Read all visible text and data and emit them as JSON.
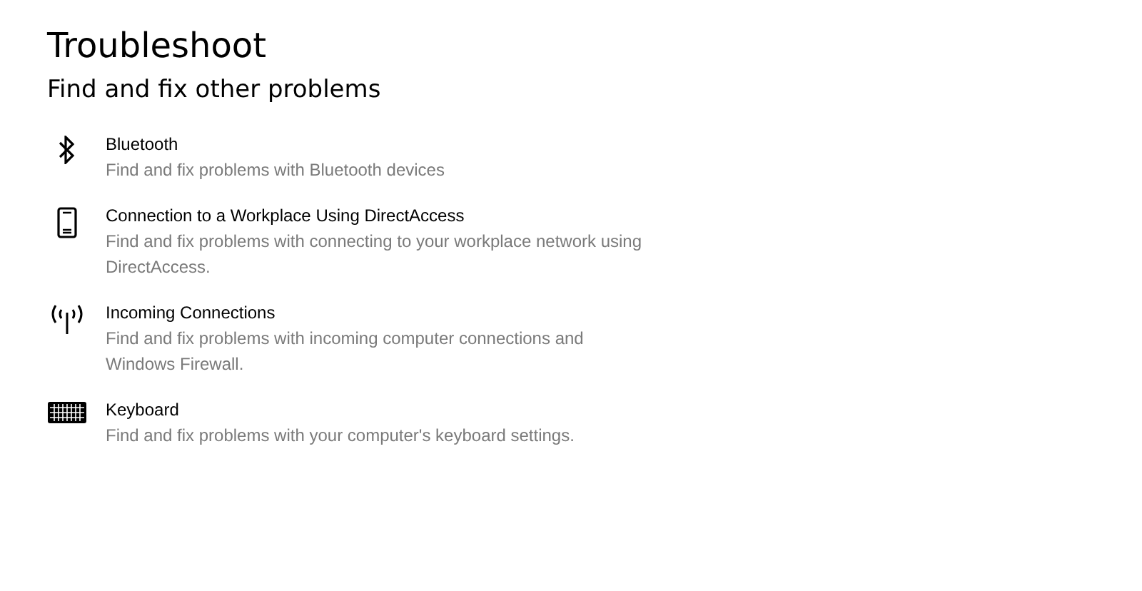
{
  "page": {
    "title": "Troubleshoot",
    "subtitle": "Find and fix other problems"
  },
  "troubleshooters": [
    {
      "kind": "bluetooth",
      "name": "Bluetooth",
      "description": "Find and fix problems with Bluetooth devices"
    },
    {
      "kind": "phone",
      "name": "Connection to a Workplace Using DirectAccess",
      "description": "Find and fix problems with connecting to your workplace network using DirectAccess."
    },
    {
      "kind": "antenna",
      "name": "Incoming Connections",
      "description": "Find and fix problems with incoming computer connections and Windows Firewall."
    },
    {
      "kind": "keyboard",
      "name": "Keyboard",
      "description": "Find and fix problems with your computer's keyboard settings."
    }
  ]
}
